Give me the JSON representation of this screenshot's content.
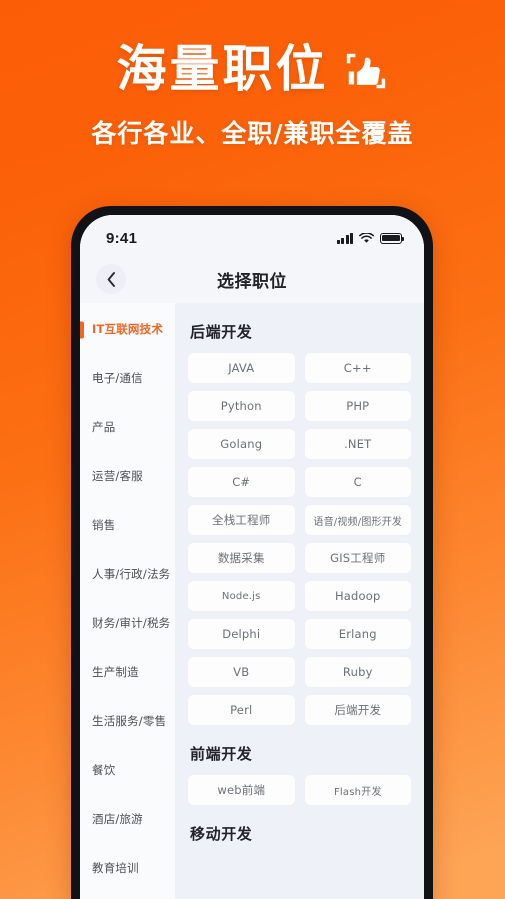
{
  "promo": {
    "title": "海量职位",
    "icon": "thumbs-up-icon",
    "subtitle": "各行各业、全职/兼职全覆盖",
    "background_top_color": "#FB5D07",
    "background_bottom_color": "#FDA455",
    "text_color": "#FFFFFF"
  },
  "phone": {
    "statusbar": {
      "time": "9:41",
      "signal_icon": "cellular-signal-icon",
      "wifi_icon": "wifi-icon",
      "battery_icon": "battery-full-icon"
    },
    "navbar": {
      "back_icon": "chevron-left-icon",
      "title": "选择职位"
    },
    "sidebar": {
      "active_index": 0,
      "active_color": "#F26522",
      "items": [
        {
          "label": "IT互联网技术"
        },
        {
          "label": "电子/通信"
        },
        {
          "label": "产品"
        },
        {
          "label": "运营/客服"
        },
        {
          "label": "销售"
        },
        {
          "label": "人事/行政/法务"
        },
        {
          "label": "财务/审计/税务"
        },
        {
          "label": "生产制造"
        },
        {
          "label": "生活服务/零售"
        },
        {
          "label": "餐饮"
        },
        {
          "label": "酒店/旅游"
        },
        {
          "label": "教育培训"
        }
      ]
    },
    "panel": {
      "sections": [
        {
          "title": "后端开发",
          "tags": [
            "JAVA",
            "C++",
            "Python",
            "PHP",
            "Golang",
            ".NET",
            "C#",
            "C",
            "全栈工程师",
            "语音/视频/图形开发",
            "数据采集",
            "GIS工程师",
            "Node.js",
            "Hadoop",
            "Delphi",
            "Erlang",
            "VB",
            "Ruby",
            "Perl",
            "后端开发"
          ]
        },
        {
          "title": "前端开发",
          "tags": [
            "web前端",
            "Flash开发"
          ]
        },
        {
          "title": "移动开发",
          "tags": []
        }
      ]
    }
  }
}
